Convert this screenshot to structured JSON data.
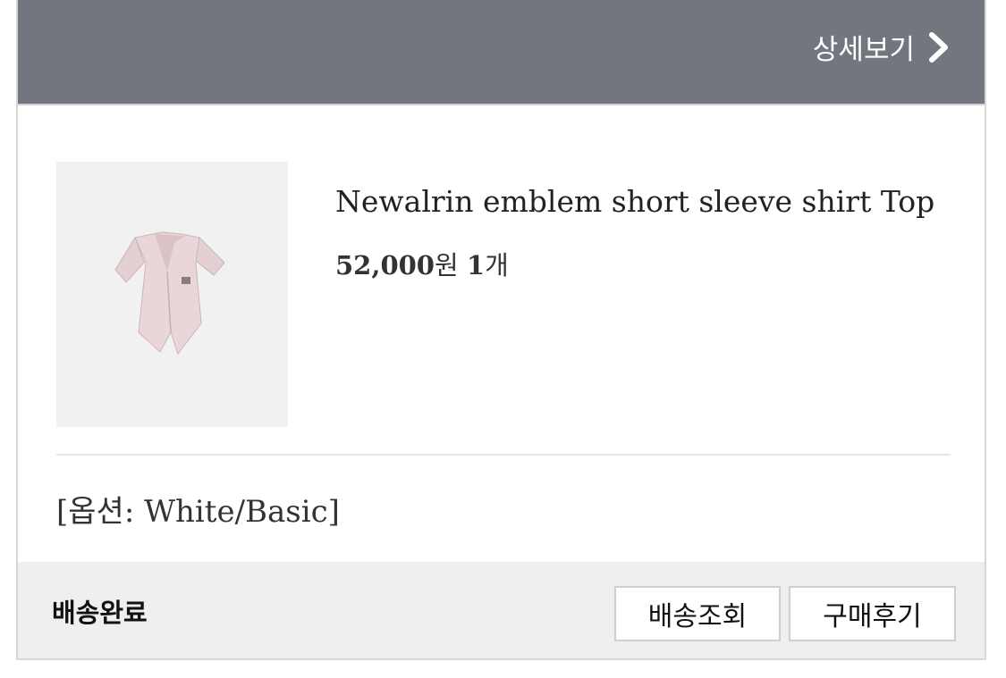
{
  "header": {
    "detail_label": "상세보기",
    "chevron_icon": "chevron-right-icon",
    "bg_color": "#72767f"
  },
  "product": {
    "name": "Newalrin emblem short sleeve shirt Top",
    "price": "52,000",
    "currency_unit": "원",
    "quantity": "1",
    "quantity_unit": "개",
    "option": "[옵션: White/Basic]",
    "image_icon": "pink-short-sleeve-shirt-image"
  },
  "footer": {
    "status": "배송완료",
    "track_button": "배송조회",
    "review_button": "구매후기"
  }
}
